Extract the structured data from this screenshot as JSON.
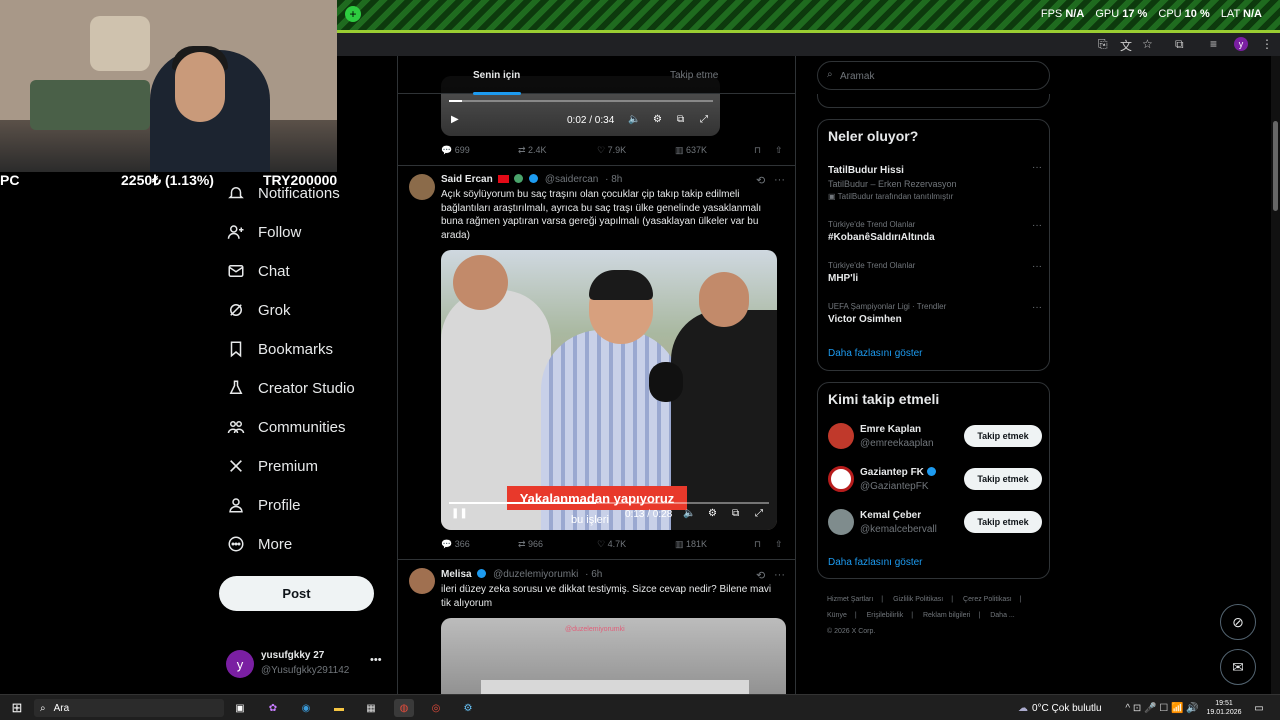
{
  "overlay": {
    "hud": [
      {
        "label": "FPS",
        "value": "N/A"
      },
      {
        "label": "GPU",
        "value": "17 %"
      },
      {
        "label": "CPU",
        "value": "10 %"
      },
      {
        "label": "LAT",
        "value": "N/A"
      }
    ],
    "ticker": {
      "left": "PC",
      "price": "2250₺ (1.13%)",
      "right": "TRY200000"
    }
  },
  "nav": {
    "items": [
      {
        "label": "Notifications",
        "icon": "bell-icon"
      },
      {
        "label": "Follow",
        "icon": "person-add-icon"
      },
      {
        "label": "Chat",
        "icon": "mail-icon"
      },
      {
        "label": "Grok",
        "icon": "grok-icon"
      },
      {
        "label": "Bookmarks",
        "icon": "bookmark-icon"
      },
      {
        "label": "Creator Studio",
        "icon": "flask-icon"
      },
      {
        "label": "Communities",
        "icon": "people-icon"
      },
      {
        "label": "Premium",
        "icon": "x-logo-icon"
      },
      {
        "label": "Profile",
        "icon": "person-icon"
      },
      {
        "label": "More",
        "icon": "more-circle-icon"
      }
    ],
    "post_label": "Post",
    "account": {
      "initial": "y",
      "name": "yusufgkky 27",
      "handle": "@Yusufgkky291142"
    }
  },
  "timeline": {
    "tabs": [
      "Senin için",
      "Takip etme"
    ],
    "video1": {
      "time": "0:02 / 0:34"
    },
    "actions1": {
      "replies": "699",
      "reposts": "2.4K",
      "likes": "7.9K",
      "views": "637K"
    },
    "tweet1": {
      "name": "Said Ercan",
      "handle": "@saidercan",
      "time": "· 8h",
      "text": "Açık söylüyorum bu saç traşını olan çocuklar çip takıp takip edilmeli bağlantıları araştırılmalı, ayrıca bu saç traşı ülke genelinde yasaklanmalı buna rağmen yaptıran varsa gereği yapılmalı (yasaklayan ülkeler var bu arada)",
      "caption": "Yakalanmadan yapıyoruz",
      "caption2": "bu işleri",
      "time_label": "0:13 / 0:28",
      "replies": "366",
      "reposts": "966",
      "likes": "4.7K",
      "views": "181K"
    },
    "tweet2": {
      "name": "Melisa",
      "handle": "@duzelemiyorumki",
      "time": "· 6h",
      "text": "ileri düzey zeka sorusu ve dikkat testiymiş. Sizce cevap nedir? Bilene mavi tik alıyorum",
      "watermark": "@duzelemiyorumki"
    }
  },
  "sidebar": {
    "search_placeholder": "Aramak",
    "trends_title": "Neler oluyor?",
    "trends": [
      {
        "category": "",
        "title": "TatilBudur Hissi",
        "sub": "TatilBudur – Erken Rezervasyon",
        "promo": "TatilBudur tarafından tanıtılmıştır"
      },
      {
        "category": "Türkiye'de Trend Olanlar",
        "title": "#KobanêSaldırıAltında"
      },
      {
        "category": "Türkiye'de Trend Olanlar",
        "title": "MHP'li"
      },
      {
        "category": "UEFA Şampiyonlar Ligi · Trendler",
        "title": "Victor Osimhen"
      }
    ],
    "show_more": "Daha fazlasını göster",
    "wtf_title": "Kimi takip etmeli",
    "wtf": [
      {
        "name": "Emre Kaplan",
        "handle": "@emreekaaplan",
        "button": "Takip etmek",
        "color": "#c0392b"
      },
      {
        "name": "Gaziantep FK",
        "handle": "@GaziantepFK",
        "button": "Takip etmek",
        "color": "#ffffff"
      },
      {
        "name": "Kemal Çeber",
        "handle": "@kemalcebervall",
        "button": "Takip etmek",
        "color": "#7f8c8d"
      }
    ],
    "wtf_more": "Daha fazlasını göster",
    "footer": [
      "Hizmet Şartları",
      "Gizlilik Politikası",
      "Çerez Politikası",
      "Künye",
      "Erişilebilirlik",
      "Reklam bilgileri",
      "Daha ...",
      "© 2026 X Corp."
    ]
  },
  "taskbar": {
    "search": "Ara",
    "weather": "0°C  Çok bulutlu",
    "time": "19:51",
    "date": "19.01.2026"
  }
}
